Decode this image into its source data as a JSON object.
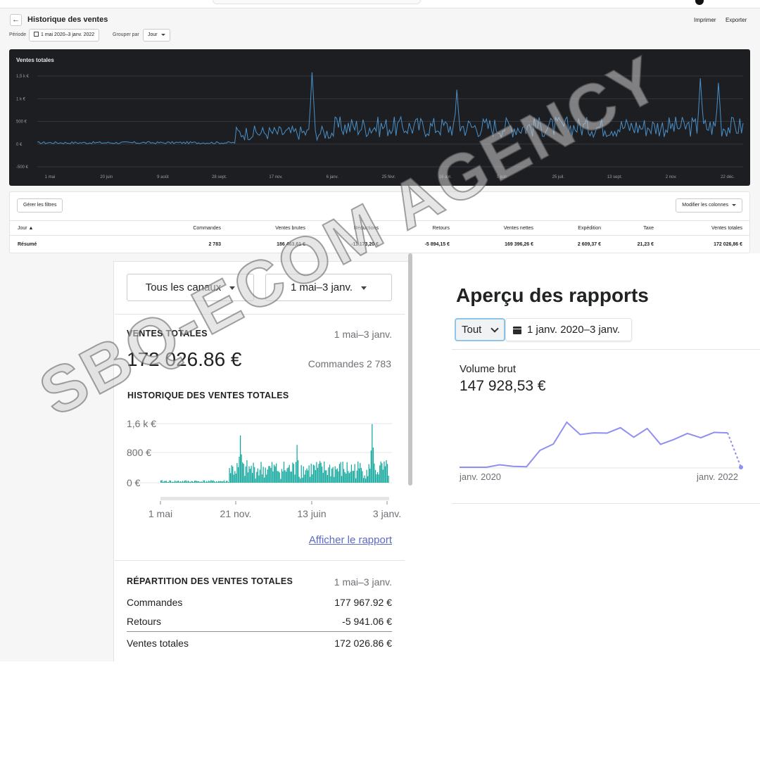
{
  "top": {
    "title": "Historique des ventes",
    "print_label": "Imprimer",
    "export_label": "Exporter",
    "period_label": "Période",
    "period_value": "1 mai 2020–3 janv. 2022",
    "group_label": "Grouper par",
    "group_value": "Jour",
    "chart_title": "Ventes totales",
    "manage_filters": "Gérer les filtres",
    "edit_columns": "Modifier les colonnes",
    "table": {
      "headers": [
        "Jour",
        "Commandes",
        "Ventes brutes",
        "Réductions",
        "Retours",
        "Ventes nettes",
        "Expédition",
        "Taxe",
        "Ventes totales"
      ],
      "summary_row": [
        "Résumé",
        "2 783",
        "186 463,61 €",
        "-11 173,20 €",
        "-5 894,15 €",
        "169 396,26 €",
        "2 609,37 €",
        "21,23 €",
        "172 026,86 €"
      ]
    }
  },
  "left": {
    "channels_select": "Tous les canaux",
    "range_select": "1 mai–3 janv.",
    "total_label": "VENTES TOTALES",
    "total_range": "1 mai–3 janv.",
    "total_amount": "172 026.86 €",
    "orders_text": "Commandes 2 783",
    "history_label": "HISTORIQUE DES VENTES TOTALES",
    "view_report": "Afficher le rapport",
    "breakdown_label": "RÉPARTITION DES VENTES TOTALES",
    "breakdown_range": "1 mai–3 janv.",
    "rows": [
      {
        "label": "Commandes",
        "value": "177 967.92 €"
      },
      {
        "label": "Retours",
        "value": "-5 941.06 €"
      },
      {
        "label": "Ventes totales",
        "value": "172 026.86 €"
      }
    ]
  },
  "right": {
    "title": "Aperçu des rapports",
    "filter_value": "Tout",
    "date_range": "1 janv. 2020–3 janv.",
    "metric_label": "Volume brut",
    "metric_value": "147 928,53 €",
    "axis_start": "janv. 2020",
    "axis_end": "janv. 2022"
  },
  "watermark": "SBQ-ECOM AGENCY",
  "chart_data": [
    {
      "type": "line",
      "title": "Ventes totales",
      "x_ticks": [
        "1 mai",
        "20 juin",
        "9 août",
        "28 sept.",
        "17 nov.",
        "6 janv.",
        "25 févr.",
        "16 avr.",
        "5 juin",
        "25 juil.",
        "13 sept.",
        "2 nov.",
        "22 déc."
      ],
      "y_ticks": [
        "1,5 k €",
        "1 k €",
        "500 €",
        "0 €",
        "-500 €"
      ],
      "ylim": [
        -500,
        1500
      ],
      "series": [
        {
          "color": "#4a90c8",
          "segments": [
            {
              "from": 0,
              "to": 0.28,
              "level": 30,
              "noise": 25
            },
            {
              "from": 0.28,
              "to": 0.42,
              "level": 250,
              "noise": 160
            },
            {
              "from": 0.42,
              "to": 1.0,
              "level": 380,
              "noise": 230
            }
          ],
          "peaks": [
            {
              "at": 0.39,
              "value": 1580
            },
            {
              "at": 0.595,
              "value": 1200
            },
            {
              "at": 0.94,
              "value": 1450
            },
            {
              "at": 0.965,
              "value": 1350
            }
          ]
        }
      ]
    },
    {
      "type": "bar",
      "title": "HISTORIQUE DES VENTES TOTALES",
      "x_ticks": [
        "1 mai",
        "21 nov.",
        "13 juin",
        "3 janv."
      ],
      "y_ticks": [
        "1,6 k €",
        "800 €",
        "0 €"
      ],
      "ylim": [
        -200,
        1800
      ],
      "series": [
        {
          "color": "#13a89e",
          "segments": [
            {
              "from": 0,
              "to": 0.3,
              "level": 40,
              "noise": 30
            },
            {
              "from": 0.3,
              "to": 1.0,
              "level": 350,
              "noise": 250
            }
          ],
          "peaks": [
            {
              "at": 0.35,
              "value": 1250
            },
            {
              "at": 0.6,
              "value": 1000
            },
            {
              "at": 0.93,
              "value": 1550
            }
          ]
        }
      ]
    },
    {
      "type": "line",
      "title": "Volume brut",
      "x_ticks": [
        "janv. 2020",
        "janv. 2022"
      ],
      "ylim": [
        0,
        14000
      ],
      "series": [
        {
          "color": "#8f8ff0",
          "values": [
            0,
            0,
            0,
            900,
            300,
            200,
            6200,
            8500,
            16500,
            12000,
            12600,
            12500,
            14500,
            11000,
            14200,
            8400,
            10200,
            12400,
            10800,
            12800,
            12600,
            0
          ]
        }
      ]
    }
  ]
}
